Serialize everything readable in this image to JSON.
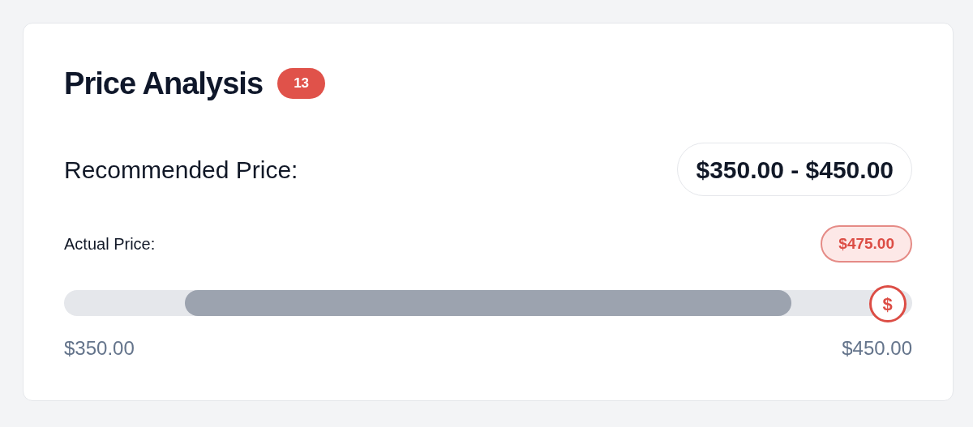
{
  "card": {
    "title": "Price Analysis",
    "badge": "13"
  },
  "recommended": {
    "label": "Recommended Price:",
    "value": "$350.00 - $450.00"
  },
  "actual": {
    "label": "Actual Price:",
    "value": "$475.00"
  },
  "range_bar": {
    "marker": {
      "icon": "$",
      "level": 0.971
    }
  },
  "range_labels": {
    "min": "$350.00",
    "max": "$450.00"
  }
}
